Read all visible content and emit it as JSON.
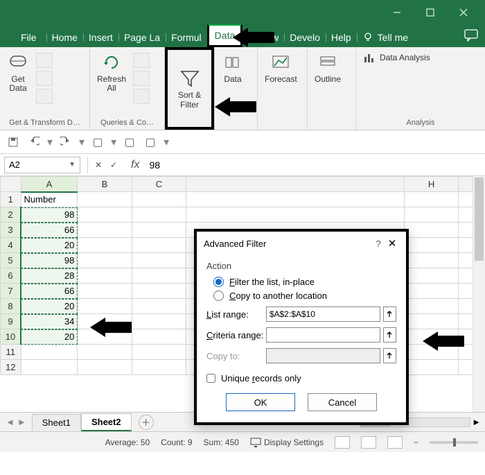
{
  "tabs": {
    "file": "File",
    "home": "Home",
    "insert": "Insert",
    "pagel": "Page La",
    "formul": "Formul",
    "data": "Data",
    "r": "R",
    "ew": "ew",
    "develo": "Develo",
    "help": "Help",
    "tellme": "Tell me"
  },
  "ribbon": {
    "getdata": "Get\nData",
    "refresh": "Refresh\nAll",
    "sortfilter": "Sort &\nFilter",
    "datatools": "Data",
    "forecast": "Forecast",
    "outline": "Outline",
    "analysis_btn": "Data Analysis",
    "group_getxform": "Get & Transform D…",
    "group_queries": "Queries & Co…",
    "group_analysis": "Analysis"
  },
  "namebox": "A2",
  "formula": "98",
  "header": "Number",
  "col_letters": [
    "A",
    "B",
    "C",
    "H"
  ],
  "rows": [
    98,
    66,
    20,
    98,
    28,
    66,
    20,
    34,
    20
  ],
  "sheets": {
    "s1": "Sheet1",
    "s2": "Sheet2"
  },
  "status": {
    "avg_lbl": "Average:",
    "avg": "50",
    "cnt_lbl": "Count:",
    "cnt": "9",
    "sum_lbl": "Sum:",
    "sum": "450",
    "disp": "Display Settings"
  },
  "dialog": {
    "title": "Advanced Filter",
    "action": "Action",
    "opt1_pre": "F",
    "opt1_rest": "ilter the list, in-place",
    "opt2_pre": "C",
    "opt2_rest": "opy to another location",
    "list_lbl_pre": "L",
    "list_lbl_rest": "ist range:",
    "list_val": "$A$2:$A$10",
    "crit_lbl_pre": "C",
    "crit_lbl_rest": "riteria range:",
    "copy_lbl": "Copy to:",
    "unique_pre": "Unique ",
    "unique_u": "r",
    "unique_post": "ecords only",
    "ok": "OK",
    "cancel": "Cancel"
  }
}
